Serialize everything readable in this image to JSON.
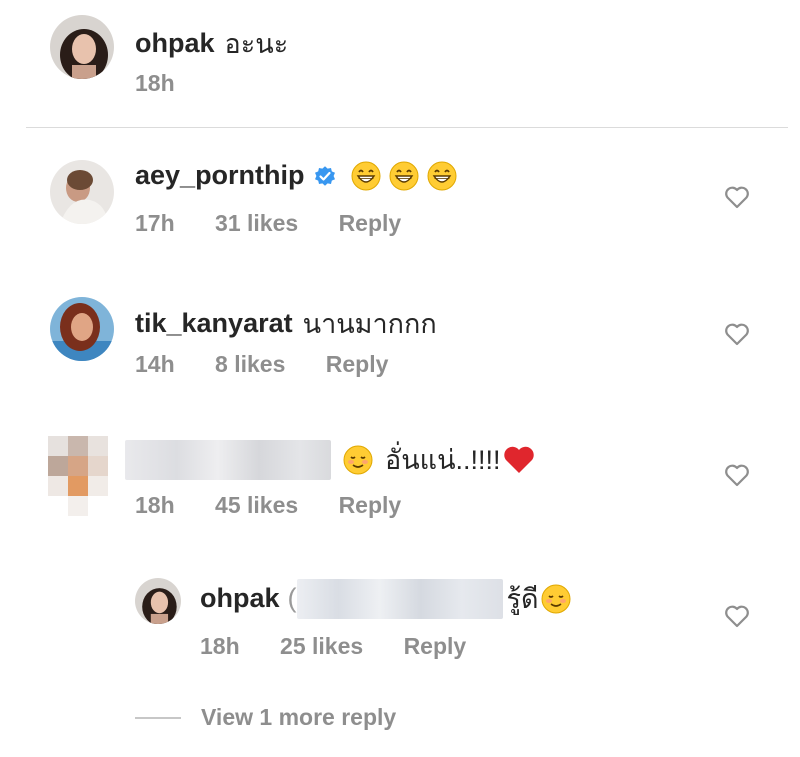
{
  "comments": [
    {
      "username": "ohpak",
      "text": "อะนะ",
      "time": "18h",
      "avatar_icon": "user-avatar-icon"
    },
    {
      "username": "aey_pornthip",
      "verified": true,
      "emoji": [
        "grinning-face-icon",
        "grinning-face-icon",
        "grinning-face-icon"
      ],
      "time": "17h",
      "likes": "31 likes",
      "reply": "Reply"
    },
    {
      "username": "tik_kanyarat",
      "text": "นานมากกก",
      "time": "14h",
      "likes": "8 likes",
      "reply": "Reply"
    },
    {
      "username_blurred": true,
      "text": "อั่นแน่..!!!!",
      "emoji_before": "smiling-face-icon",
      "emoji_after": "red-heart-icon",
      "time": "18h",
      "likes": "45 likes",
      "reply": "Reply"
    },
    {
      "username": "ohpak",
      "text_prefix": "(",
      "text_suffix": "รู้ดี",
      "emoji_after": "smiling-face-icon",
      "time": "18h",
      "likes": "25 likes",
      "reply": "Reply"
    }
  ],
  "view_more": "View 1 more reply",
  "colors": {
    "text": "#262626",
    "meta": "#8e8e8e",
    "verified": "#3897f0",
    "heart": "#8e8e8e"
  }
}
